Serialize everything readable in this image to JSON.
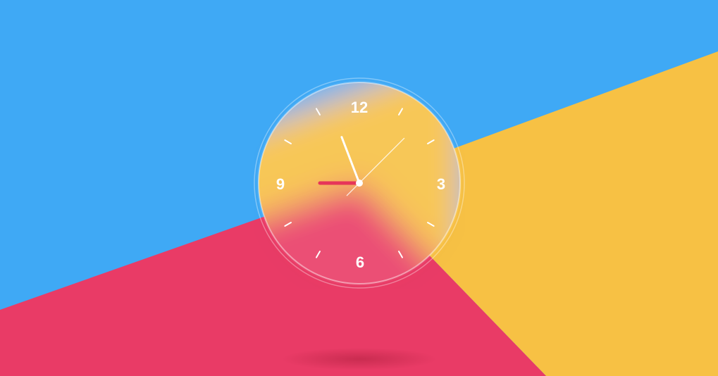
{
  "scene": {
    "colors": {
      "blue": "#3fa9f5",
      "yellow": "#f7c144",
      "pink": "#e93b66",
      "hand_white": "#ffffff",
      "second_hand": "#e63559"
    }
  },
  "clock": {
    "numerals": [
      "12",
      "3",
      "6",
      "9"
    ],
    "time": {
      "hour": 11,
      "minute": 57,
      "second": 45
    }
  }
}
